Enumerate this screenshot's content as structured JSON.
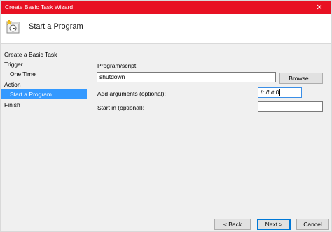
{
  "window": {
    "title": "Create Basic Task Wizard",
    "close_glyph": "✕"
  },
  "header": {
    "heading": "Start a Program",
    "icon": "task-scheduler-icon"
  },
  "sidebar": {
    "items": [
      {
        "label": "Create a Basic Task",
        "selected": false
      },
      {
        "label": "Trigger",
        "selected": false
      },
      {
        "label": "One Time",
        "selected": false
      },
      {
        "label": "Action",
        "selected": false
      },
      {
        "label": "Start a Program",
        "selected": true
      },
      {
        "label": "Finish",
        "selected": false
      }
    ]
  },
  "form": {
    "program_label": "Program/script:",
    "program_value": "shutdown",
    "browse_label": "Browse...",
    "args_label": "Add arguments (optional):",
    "args_value": "/r /f /t 0",
    "startin_label": "Start in (optional):",
    "startin_value": ""
  },
  "buttons": {
    "back": "< Back",
    "next": "Next >",
    "cancel": "Cancel"
  },
  "colors": {
    "titlebar": "#e81123",
    "selection": "#3399ff",
    "focus_border": "#0078d7"
  }
}
